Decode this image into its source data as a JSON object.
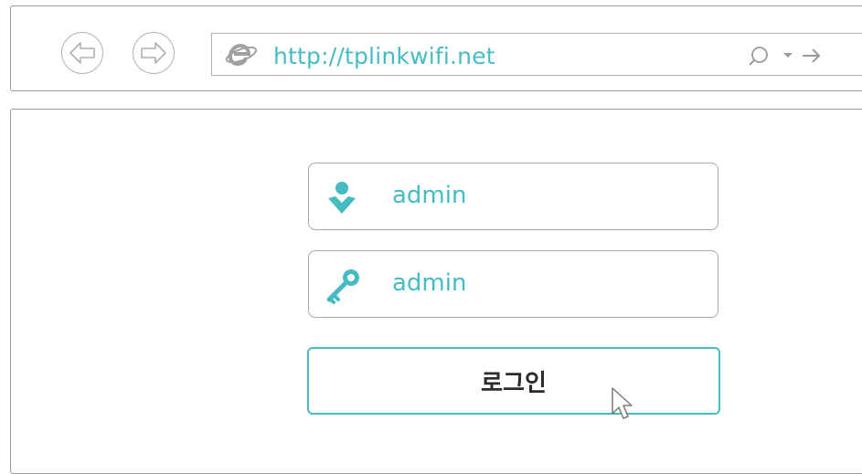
{
  "browser": {
    "url": "http://tplinkwifi.net",
    "icons": {
      "back": "back-arrow-icon",
      "forward": "forward-arrow-icon",
      "browser_logo": "internet-explorer-icon",
      "search": "search-icon",
      "dropdown": "dropdown-icon",
      "go": "go-arrow-icon"
    }
  },
  "login": {
    "username_value": "admin",
    "password_value": "admin",
    "button_label": "로그인",
    "icons": {
      "username": "user-icon",
      "password": "key-icon",
      "cursor": "mouse-pointer-icon"
    }
  },
  "colors": {
    "accent": "#45bcc2",
    "border": "#a8a8a8",
    "text": "#2b2b2b"
  }
}
